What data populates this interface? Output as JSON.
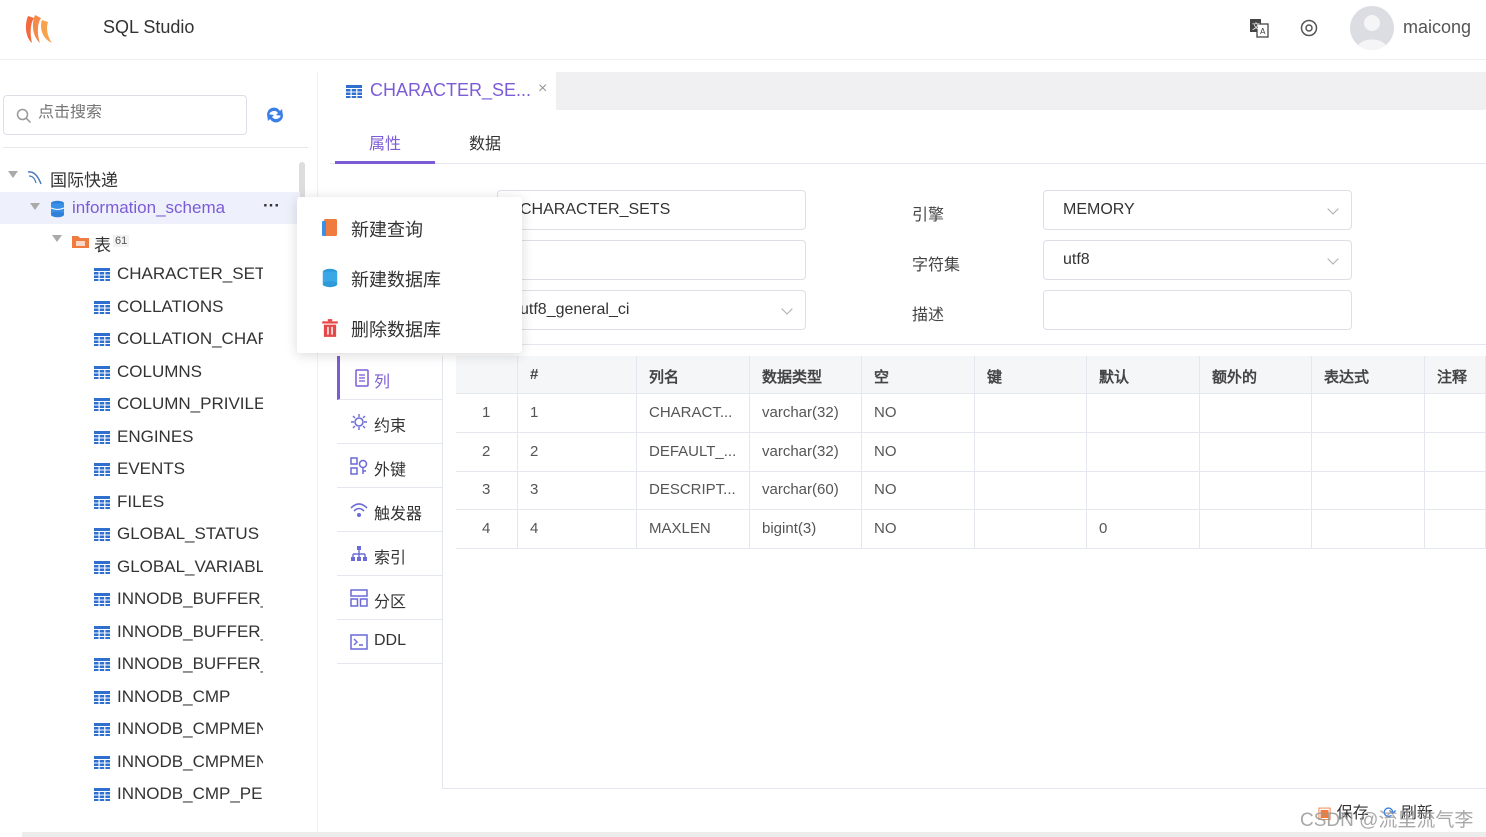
{
  "header": {
    "app_title": "SQL Studio",
    "username": "maicong",
    "icons": [
      "logo-icon",
      "translate-icon",
      "settings-icon",
      "avatar"
    ]
  },
  "sidebar": {
    "search_placeholder": "点击搜索",
    "tree": {
      "connection": "国际快递",
      "database": "information_schema",
      "database_more": "···",
      "folder_label": "表",
      "folder_count": "61",
      "tables": [
        "CHARACTER_SETS",
        "COLLATIONS",
        "COLLATION_CHAR",
        "COLUMNS",
        "COLUMN_PRIVILEG",
        "ENGINES",
        "EVENTS",
        "FILES",
        "GLOBAL_STATUS",
        "GLOBAL_VARIABLE",
        "INNODB_BUFFER_F",
        "INNODB_BUFFER_F",
        "INNODB_BUFFER_F",
        "INNODB_CMP",
        "INNODB_CMPMEN",
        "INNODB_CMPMEN",
        "INNODB_CMP_PER"
      ]
    }
  },
  "context_menu": {
    "items": [
      "新建查询",
      "新建数据库",
      "删除数据库"
    ]
  },
  "main": {
    "tab_title": "CHARACTER_SE...",
    "tab_close": "×",
    "subtabs": [
      "属性",
      "数据"
    ],
    "form": {
      "name_value": "CHARACTER_SETS",
      "field2_value": "",
      "collation_value": "utf8_general_ci",
      "engine_label": "引擎",
      "engine_value": "MEMORY",
      "charset_label": "字符集",
      "charset_value": "utf8",
      "desc_label": "描述",
      "desc_value": ""
    },
    "vmenu": [
      "列",
      "约束",
      "外键",
      "触发器",
      "索引",
      "分区",
      "DDL"
    ],
    "grid": {
      "headers": [
        "",
        "#",
        "列名",
        "数据类型",
        "空",
        "键",
        "默认",
        "额外的",
        "表达式",
        "注释"
      ],
      "rows": [
        [
          "1",
          "1",
          "CHARACT...",
          "varchar(32)",
          "NO",
          "",
          "",
          "",
          "",
          ""
        ],
        [
          "2",
          "2",
          "DEFAULT_...",
          "varchar(32)",
          "NO",
          "",
          "",
          "",
          "",
          ""
        ],
        [
          "3",
          "3",
          "DESCRIPT...",
          "varchar(60)",
          "NO",
          "",
          "",
          "",
          "",
          ""
        ],
        [
          "4",
          "4",
          "MAXLEN",
          "bigint(3)",
          "NO",
          "",
          "0",
          "",
          "",
          ""
        ]
      ]
    },
    "footer": {
      "save": "保存",
      "refresh": "刷新"
    }
  },
  "watermark": "CSDN @流里流气李",
  "colors": {
    "accent": "#7c5cd6",
    "table_icon": "#2f6fd0",
    "folder": "#f07b3f",
    "delete": "#e54848"
  }
}
